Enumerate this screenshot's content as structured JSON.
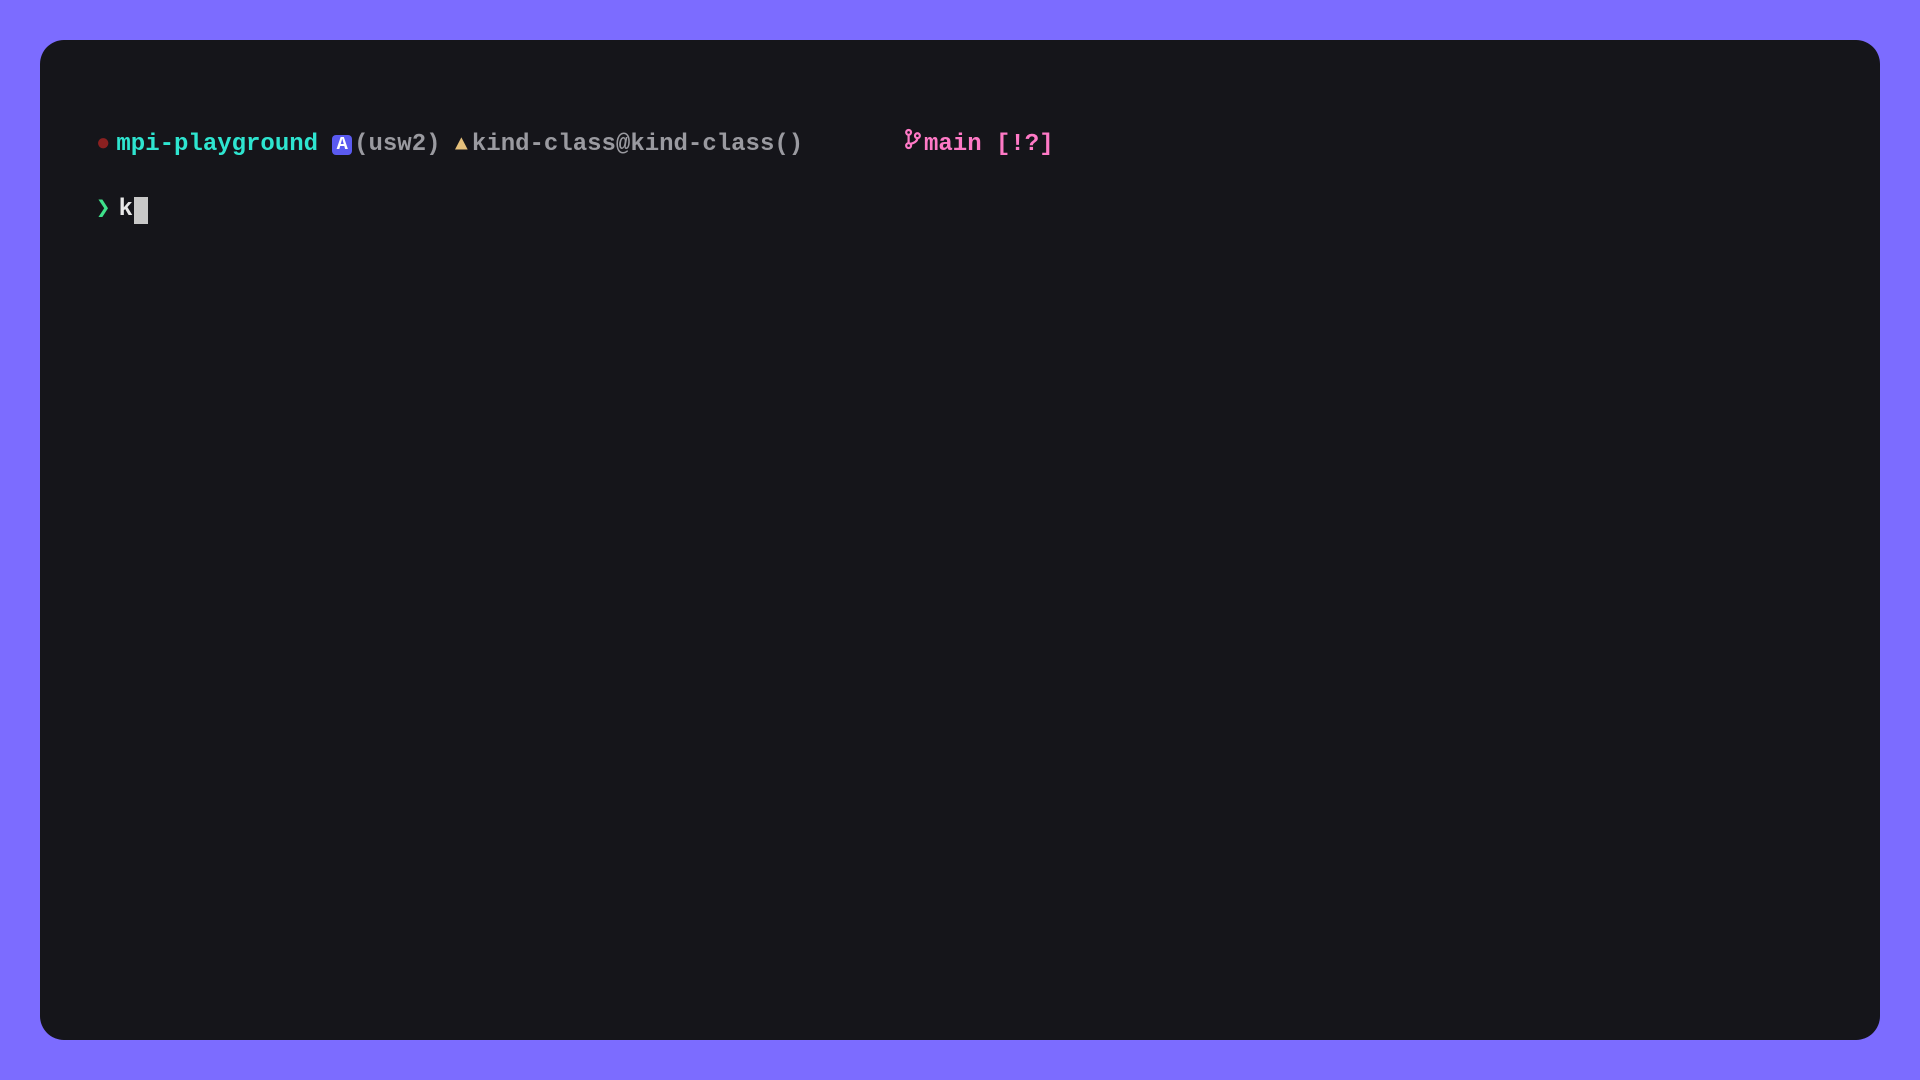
{
  "prompt": {
    "record_icon": "●",
    "project": "mpi-playground",
    "badge": "A",
    "region": "(usw2)",
    "triangle": "▲",
    "k8s_context": "kind-class@kind-class()",
    "branch_icon": "⎇",
    "branch_name": "main",
    "git_status": "[!?]"
  },
  "input": {
    "arrow": "❯",
    "typed": "k"
  }
}
